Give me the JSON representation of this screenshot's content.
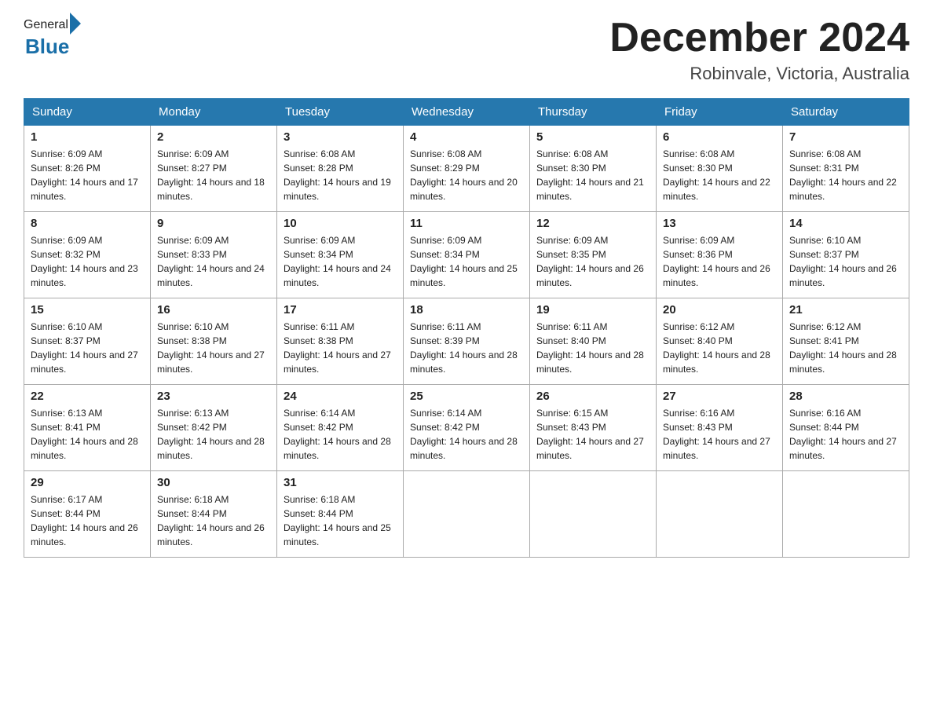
{
  "header": {
    "logo_general": "General",
    "logo_blue": "Blue",
    "month_title": "December 2024",
    "location": "Robinvale, Victoria, Australia"
  },
  "days_of_week": [
    "Sunday",
    "Monday",
    "Tuesday",
    "Wednesday",
    "Thursday",
    "Friday",
    "Saturday"
  ],
  "weeks": [
    [
      {
        "day": "1",
        "sunrise": "6:09 AM",
        "sunset": "8:26 PM",
        "daylight": "14 hours and 17 minutes."
      },
      {
        "day": "2",
        "sunrise": "6:09 AM",
        "sunset": "8:27 PM",
        "daylight": "14 hours and 18 minutes."
      },
      {
        "day": "3",
        "sunrise": "6:08 AM",
        "sunset": "8:28 PM",
        "daylight": "14 hours and 19 minutes."
      },
      {
        "day": "4",
        "sunrise": "6:08 AM",
        "sunset": "8:29 PM",
        "daylight": "14 hours and 20 minutes."
      },
      {
        "day": "5",
        "sunrise": "6:08 AM",
        "sunset": "8:30 PM",
        "daylight": "14 hours and 21 minutes."
      },
      {
        "day": "6",
        "sunrise": "6:08 AM",
        "sunset": "8:30 PM",
        "daylight": "14 hours and 22 minutes."
      },
      {
        "day": "7",
        "sunrise": "6:08 AM",
        "sunset": "8:31 PM",
        "daylight": "14 hours and 22 minutes."
      }
    ],
    [
      {
        "day": "8",
        "sunrise": "6:09 AM",
        "sunset": "8:32 PM",
        "daylight": "14 hours and 23 minutes."
      },
      {
        "day": "9",
        "sunrise": "6:09 AM",
        "sunset": "8:33 PM",
        "daylight": "14 hours and 24 minutes."
      },
      {
        "day": "10",
        "sunrise": "6:09 AM",
        "sunset": "8:34 PM",
        "daylight": "14 hours and 24 minutes."
      },
      {
        "day": "11",
        "sunrise": "6:09 AM",
        "sunset": "8:34 PM",
        "daylight": "14 hours and 25 minutes."
      },
      {
        "day": "12",
        "sunrise": "6:09 AM",
        "sunset": "8:35 PM",
        "daylight": "14 hours and 26 minutes."
      },
      {
        "day": "13",
        "sunrise": "6:09 AM",
        "sunset": "8:36 PM",
        "daylight": "14 hours and 26 minutes."
      },
      {
        "day": "14",
        "sunrise": "6:10 AM",
        "sunset": "8:37 PM",
        "daylight": "14 hours and 26 minutes."
      }
    ],
    [
      {
        "day": "15",
        "sunrise": "6:10 AM",
        "sunset": "8:37 PM",
        "daylight": "14 hours and 27 minutes."
      },
      {
        "day": "16",
        "sunrise": "6:10 AM",
        "sunset": "8:38 PM",
        "daylight": "14 hours and 27 minutes."
      },
      {
        "day": "17",
        "sunrise": "6:11 AM",
        "sunset": "8:38 PM",
        "daylight": "14 hours and 27 minutes."
      },
      {
        "day": "18",
        "sunrise": "6:11 AM",
        "sunset": "8:39 PM",
        "daylight": "14 hours and 28 minutes."
      },
      {
        "day": "19",
        "sunrise": "6:11 AM",
        "sunset": "8:40 PM",
        "daylight": "14 hours and 28 minutes."
      },
      {
        "day": "20",
        "sunrise": "6:12 AM",
        "sunset": "8:40 PM",
        "daylight": "14 hours and 28 minutes."
      },
      {
        "day": "21",
        "sunrise": "6:12 AM",
        "sunset": "8:41 PM",
        "daylight": "14 hours and 28 minutes."
      }
    ],
    [
      {
        "day": "22",
        "sunrise": "6:13 AM",
        "sunset": "8:41 PM",
        "daylight": "14 hours and 28 minutes."
      },
      {
        "day": "23",
        "sunrise": "6:13 AM",
        "sunset": "8:42 PM",
        "daylight": "14 hours and 28 minutes."
      },
      {
        "day": "24",
        "sunrise": "6:14 AM",
        "sunset": "8:42 PM",
        "daylight": "14 hours and 28 minutes."
      },
      {
        "day": "25",
        "sunrise": "6:14 AM",
        "sunset": "8:42 PM",
        "daylight": "14 hours and 28 minutes."
      },
      {
        "day": "26",
        "sunrise": "6:15 AM",
        "sunset": "8:43 PM",
        "daylight": "14 hours and 27 minutes."
      },
      {
        "day": "27",
        "sunrise": "6:16 AM",
        "sunset": "8:43 PM",
        "daylight": "14 hours and 27 minutes."
      },
      {
        "day": "28",
        "sunrise": "6:16 AM",
        "sunset": "8:44 PM",
        "daylight": "14 hours and 27 minutes."
      }
    ],
    [
      {
        "day": "29",
        "sunrise": "6:17 AM",
        "sunset": "8:44 PM",
        "daylight": "14 hours and 26 minutes."
      },
      {
        "day": "30",
        "sunrise": "6:18 AM",
        "sunset": "8:44 PM",
        "daylight": "14 hours and 26 minutes."
      },
      {
        "day": "31",
        "sunrise": "6:18 AM",
        "sunset": "8:44 PM",
        "daylight": "14 hours and 25 minutes."
      },
      null,
      null,
      null,
      null
    ]
  ],
  "labels": {
    "sunrise": "Sunrise:",
    "sunset": "Sunset:",
    "daylight": "Daylight:"
  }
}
